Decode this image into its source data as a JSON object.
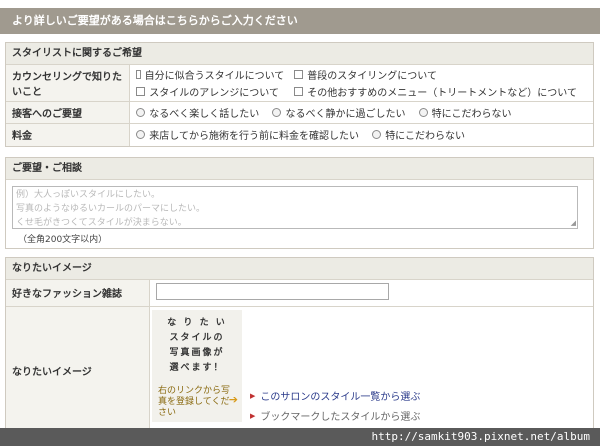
{
  "header": {
    "title": "より詳しいご要望がある場合はこちらからご入力ください"
  },
  "stylist_section": {
    "heading": "スタイリストに関するご希望",
    "rows": {
      "counseling": {
        "label": "カウンセリングで知りたいこと",
        "options": [
          "自分に似合うスタイルについて",
          "普段のスタイリングについて",
          "スタイルのアレンジについて",
          "その他おすすめのメニュー（トリートメントなど）について"
        ]
      },
      "service": {
        "label": "接客へのご要望",
        "options": [
          "なるべく楽しく話したい",
          "なるべく静かに過ごしたい",
          "特にこだわらない"
        ]
      },
      "price": {
        "label": "料金",
        "options": [
          "来店してから施術を行う前に料金を確認したい",
          "特にこだわらない"
        ]
      }
    }
  },
  "request_section": {
    "heading": "ご要望・ご相談",
    "placeholder_lines": [
      "例）大人っぽいスタイルにしたい。",
      "写真のようなゆるいカールのパーマにしたい。",
      "くせ毛がきつくてスタイルが決まらない。"
    ],
    "note": "（全角200文字以内）"
  },
  "image_section": {
    "heading": "なりたいイメージ",
    "magazine_label": "好きなファッション雑誌",
    "image_label": "なりたいイメージ",
    "image_box": {
      "lines": [
        "な り た い",
        "スタイルの",
        "写真画像が",
        "選べます！"
      ],
      "link_text": "右のリンクから写真を登録してください"
    },
    "links": [
      "このサロンのスタイル一覧から選ぶ",
      "ブックマークしたスタイルから選ぶ"
    ]
  },
  "watermark": {
    "text": "http://samkit903.pixnet.net/album"
  }
}
